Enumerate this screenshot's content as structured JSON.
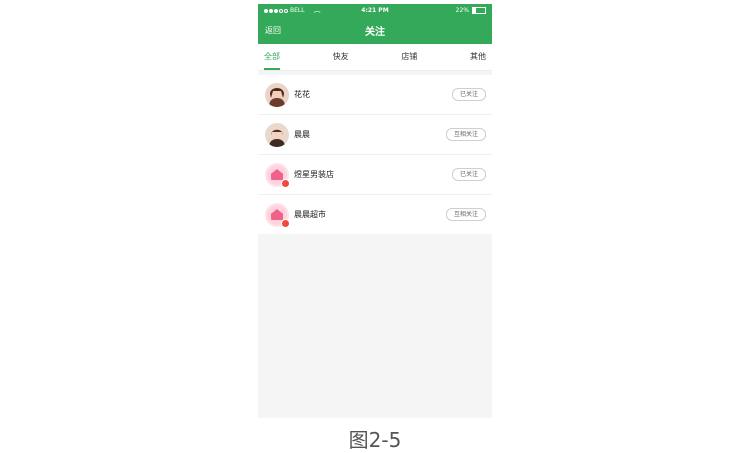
{
  "status": {
    "carrier": "BELL",
    "time": "4:21 PM",
    "battery": "22%",
    "battery_level": 0.22
  },
  "nav": {
    "back": "返回",
    "title": "关注"
  },
  "tabs": [
    "全部",
    "快友",
    "店铺",
    "其他"
  ],
  "active_tab": 0,
  "follows": [
    {
      "name": "花花",
      "status": "已关注",
      "avatar": "person-avatar"
    },
    {
      "name": "晨晨",
      "status": "互相关注",
      "avatar": "person-avatar"
    },
    {
      "name": "煜星男装店",
      "status": "已关注",
      "avatar": "shop-avatar"
    },
    {
      "name": "晨晨超市",
      "status": "互相关注",
      "avatar": "shop-avatar"
    }
  ],
  "caption": "图2-5",
  "colors": {
    "primary": "#35a95a",
    "background": "#f5f5f5",
    "badge": "#ef4b3a"
  }
}
